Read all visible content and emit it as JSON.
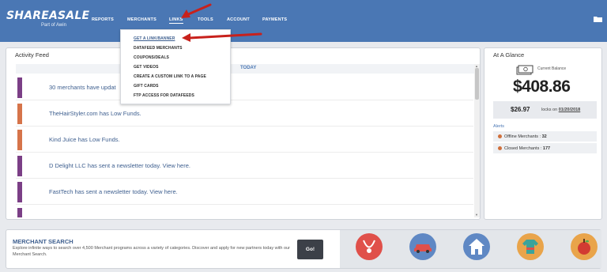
{
  "brand": {
    "logo": "SHAREASALE",
    "sub": "Part of Awin"
  },
  "nav": {
    "items": [
      {
        "label": "REPORTS"
      },
      {
        "label": "MERCHANTS"
      },
      {
        "label": "LINKS"
      },
      {
        "label": "TOOLS"
      },
      {
        "label": "ACCOUNT"
      },
      {
        "label": "PAYMENTS"
      }
    ],
    "active": "LINKS"
  },
  "dropdown": {
    "items": [
      {
        "label": "GET A LINK/BANNER"
      },
      {
        "label": "DATAFEED MERCHANTS"
      },
      {
        "label": "COUPONS/DEALS"
      },
      {
        "label": "GET VIDEOS"
      },
      {
        "label": "CREATE A CUSTOM LINK TO A PAGE"
      },
      {
        "label": "GIFT CARDS"
      },
      {
        "label": "FTP ACCESS FOR DATAFEEDS"
      }
    ]
  },
  "activity": {
    "title": "Activity Feed",
    "today_label": "TODAY",
    "items": [
      {
        "text": "30 merchants have updat",
        "color": "#7b3f86"
      },
      {
        "text": "TheHairStyler.com has Low Funds.",
        "color": "#d6744a"
      },
      {
        "text": "Kind Juice has Low Funds.",
        "color": "#d6744a"
      },
      {
        "text": "D Delight LLC has sent a newsletter today. View here.",
        "color": "#7b3f86"
      },
      {
        "text": "FastTech has sent a newsletter today. View here.",
        "color": "#7b3f86"
      },
      {
        "text": "",
        "color": "#7b3f86"
      }
    ]
  },
  "glance": {
    "title": "At A Glance",
    "balance_label": "Current Balance",
    "balance": "$408.86",
    "locks_amount": "$26.97",
    "locks_text": "locks on",
    "locks_date": "01/20/2018",
    "alerts_label": "Alerts",
    "alerts": [
      {
        "label": "Offline Merchants : ",
        "count": "32"
      },
      {
        "label": "Closed Merchants : ",
        "count": "177"
      }
    ]
  },
  "search": {
    "title": "MERCHANT SEARCH",
    "description": "Explore infinite ways to search over 4,500 Merchant programs across a variety of categories. Discover and apply for new partners today with our Merchant Search.",
    "go_label": "Go!",
    "categories": [
      {
        "icon": "necklace-icon",
        "color": "#e0504a"
      },
      {
        "icon": "car-icon",
        "color": "#5f88c4"
      },
      {
        "icon": "house-icon",
        "color": "#5f88c4"
      },
      {
        "icon": "clothing-icon",
        "color": "#e9a44a"
      },
      {
        "icon": "apple-icon",
        "color": "#e9a44a"
      }
    ]
  }
}
